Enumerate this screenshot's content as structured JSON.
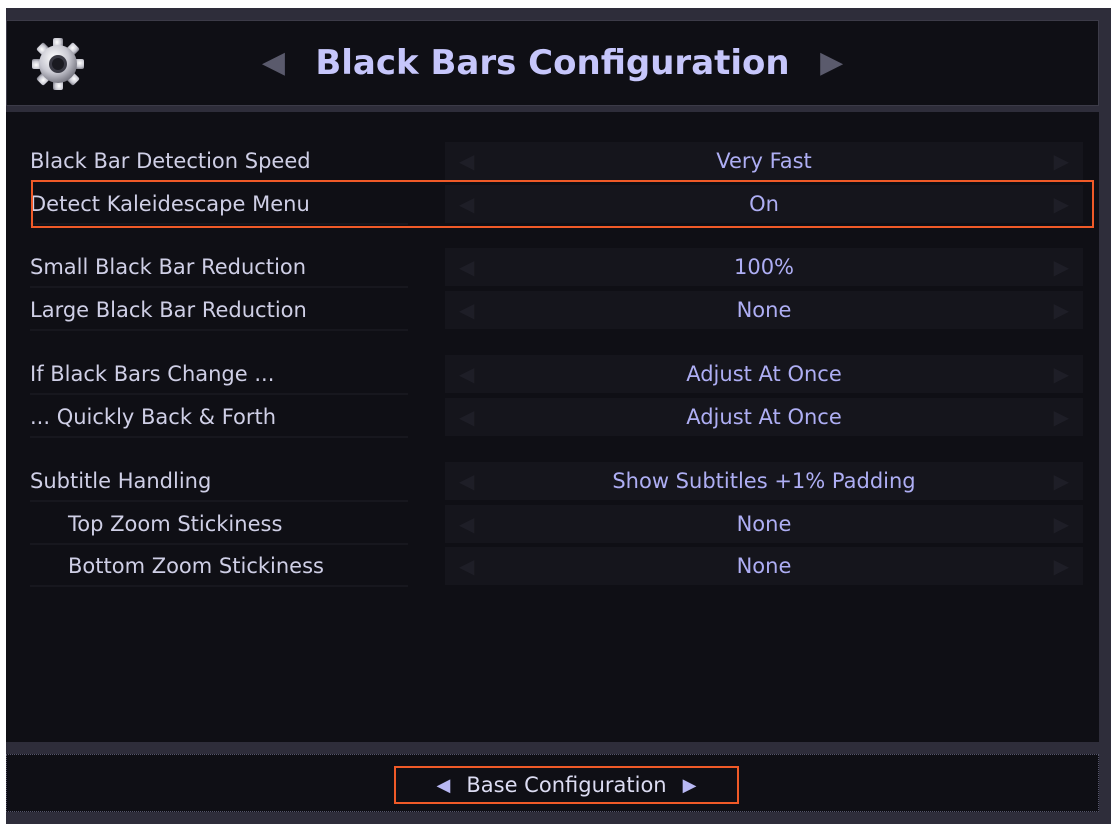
{
  "header": {
    "title": "Black Bars Configuration",
    "prev_arrow": "◀",
    "next_arrow": "▶",
    "icon": "gear-icon"
  },
  "settings": [
    {
      "label": "Black Bar Detection Speed",
      "value": "Very Fast"
    },
    {
      "label": "Detect Kaleidescape Menu",
      "value": "On",
      "highlighted": true
    },
    {
      "label": "Small Black Bar Reduction",
      "value": "100%"
    },
    {
      "label": "Large Black Bar Reduction",
      "value": "None"
    },
    {
      "label": "If Black Bars Change ...",
      "value": "Adjust At Once"
    },
    {
      "label": "... Quickly Back & Forth",
      "value": "Adjust At Once"
    },
    {
      "label": "Subtitle Handling",
      "value": "Show Subtitles +1% Padding"
    },
    {
      "label": "Top Zoom Stickiness",
      "value": "None"
    },
    {
      "label": "Bottom Zoom Stickiness",
      "value": "None"
    }
  ],
  "footer": {
    "label": "Base Configuration",
    "prev_arrow": "◀",
    "next_arrow": "▶"
  },
  "colors": {
    "title": "#c6c6fb",
    "value": "#aeaef4",
    "label": "#cfcfe6",
    "highlight": "#f05a28",
    "panel": "#0f0f15",
    "frame": "#2e2d3a"
  }
}
